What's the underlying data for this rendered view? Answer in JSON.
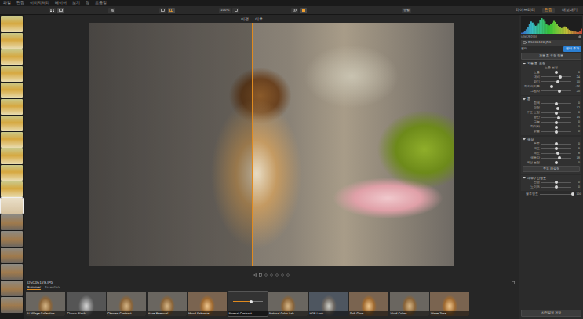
{
  "menu": [
    "파일",
    "편집",
    "이미지처리",
    "레이어",
    "보기",
    "창",
    "도움말"
  ],
  "toolbar": {
    "zoom": "100%",
    "sort": "정렬"
  },
  "modules": [
    {
      "label": "라이브러리",
      "selected": false
    },
    {
      "label": "편집",
      "selected": true
    },
    {
      "label": "내보내기",
      "selected": false
    }
  ],
  "filmstrip": [
    {
      "kind": "bottles",
      "selected": false
    },
    {
      "kind": "bottles",
      "selected": false
    },
    {
      "kind": "bottles",
      "selected": false
    },
    {
      "kind": "bottles",
      "selected": false
    },
    {
      "kind": "bottles",
      "selected": false
    },
    {
      "kind": "bottles",
      "selected": false
    },
    {
      "kind": "bottles",
      "selected": false
    },
    {
      "kind": "bottles",
      "selected": false
    },
    {
      "kind": "bottles",
      "selected": false
    },
    {
      "kind": "bottles",
      "selected": false
    },
    {
      "kind": "bottles",
      "selected": false
    },
    {
      "kind": "light",
      "selected": true
    },
    {
      "kind": "dog",
      "selected": false
    },
    {
      "kind": "dog",
      "selected": false
    },
    {
      "kind": "dog",
      "selected": false
    },
    {
      "kind": "dog",
      "selected": false
    },
    {
      "kind": "dog",
      "selected": false
    },
    {
      "kind": "dog",
      "selected": false
    }
  ],
  "viewer": {
    "before": "이전",
    "after": "이후",
    "split": 0.448
  },
  "file_name": "DSC06128.JPG",
  "preset_tabs": [
    {
      "label": "Summer",
      "selected": true
    },
    {
      "label": "Essentials",
      "selected": false
    }
  ],
  "presets": [
    {
      "label": "AI Village Collection",
      "selected": false,
      "kind": "color"
    },
    {
      "label": "Classic Black",
      "selected": false,
      "kind": "mono"
    },
    {
      "label": "Chrome Contrast",
      "selected": false,
      "kind": "color"
    },
    {
      "label": "Haze Removal",
      "selected": false,
      "kind": "color"
    },
    {
      "label": "Mood Enhance",
      "selected": false,
      "kind": "warm"
    },
    {
      "label": "Normal Contrast",
      "selected": true,
      "kind": "color",
      "level": 0.62
    },
    {
      "label": "Natural Color Lab",
      "selected": false,
      "kind": "color"
    },
    {
      "label": "HDR Look",
      "selected": false,
      "kind": "cool"
    },
    {
      "label": "Soft Glow",
      "selected": false,
      "kind": "warm"
    },
    {
      "label": "Vivid Colors",
      "selected": false,
      "kind": "color"
    },
    {
      "label": "Warm Tone",
      "selected": false,
      "kind": "warm"
    }
  ],
  "panel": {
    "navigator": "네비게이터",
    "histogram": [
      2,
      3,
      5,
      8,
      12,
      18,
      22,
      20,
      16,
      14,
      15,
      19,
      24,
      28,
      26,
      22,
      18,
      16,
      15,
      17,
      20,
      23,
      21,
      18,
      14,
      12,
      10,
      11,
      13,
      12,
      9,
      7,
      6,
      5,
      4,
      4,
      3,
      3,
      5,
      9
    ],
    "layer_name": "DSC06128.JPG",
    "filter_title": "필터",
    "add_filter": "필터 추가",
    "auto_tone": "자동 톤 조정 적용",
    "sections": [
      {
        "title": "자동 톤 조정",
        "expanded": true,
        "sub": "노출 보정",
        "sliders": [
          {
            "label": "노출",
            "level": 0.5,
            "reading": "0"
          },
          {
            "label": "대비",
            "level": 0.62,
            "reading": "24"
          },
          {
            "label": "밝기",
            "level": 0.55,
            "reading": "10"
          },
          {
            "label": "하이라이트",
            "level": 0.34,
            "reading": "-32"
          },
          {
            "label": "그림자",
            "level": 0.6,
            "reading": "20"
          }
        ]
      },
      {
        "title": "톤",
        "expanded": true,
        "sub": "",
        "sliders": [
          {
            "label": "흰색",
            "level": 0.5,
            "reading": "0"
          },
          {
            "label": "검정",
            "level": 0.56,
            "reading": "12"
          },
          {
            "label": "구조 보정",
            "level": 0.5,
            "reading": "0"
          },
          {
            "label": "중간",
            "level": 0.58,
            "reading": "15"
          },
          {
            "label": "그늘",
            "level": 0.5,
            "reading": "0"
          },
          {
            "label": "하이라",
            "level": 0.5,
            "reading": "0"
          },
          {
            "label": "밝음",
            "level": 0.5,
            "reading": "0"
          }
        ]
      },
      {
        "title": "색상",
        "expanded": true,
        "sub": "",
        "sliders": [
          {
            "label": "온도",
            "level": 0.5,
            "reading": "0"
          },
          {
            "label": "색조",
            "level": 0.5,
            "reading": "0"
          },
          {
            "label": "채도",
            "level": 0.55,
            "reading": "8"
          },
          {
            "label": "생동감",
            "level": 0.6,
            "reading": "18"
          },
          {
            "label": "색상 보정",
            "level": 0.5,
            "reading": "0"
          }
        ]
      },
      {
        "title": "세부 / 선명도",
        "expanded": true,
        "sub": "",
        "sliders": [
          {
            "label": "선명",
            "level": 0.5,
            "reading": "0"
          },
          {
            "label": "노이즈",
            "level": 0.5,
            "reading": "0"
          }
        ]
      }
    ],
    "reset_button": "모두 재설정",
    "opacity": {
      "label": "불투명도",
      "level": 1,
      "reading": "100"
    },
    "footer_button": "사전설정 저장"
  }
}
